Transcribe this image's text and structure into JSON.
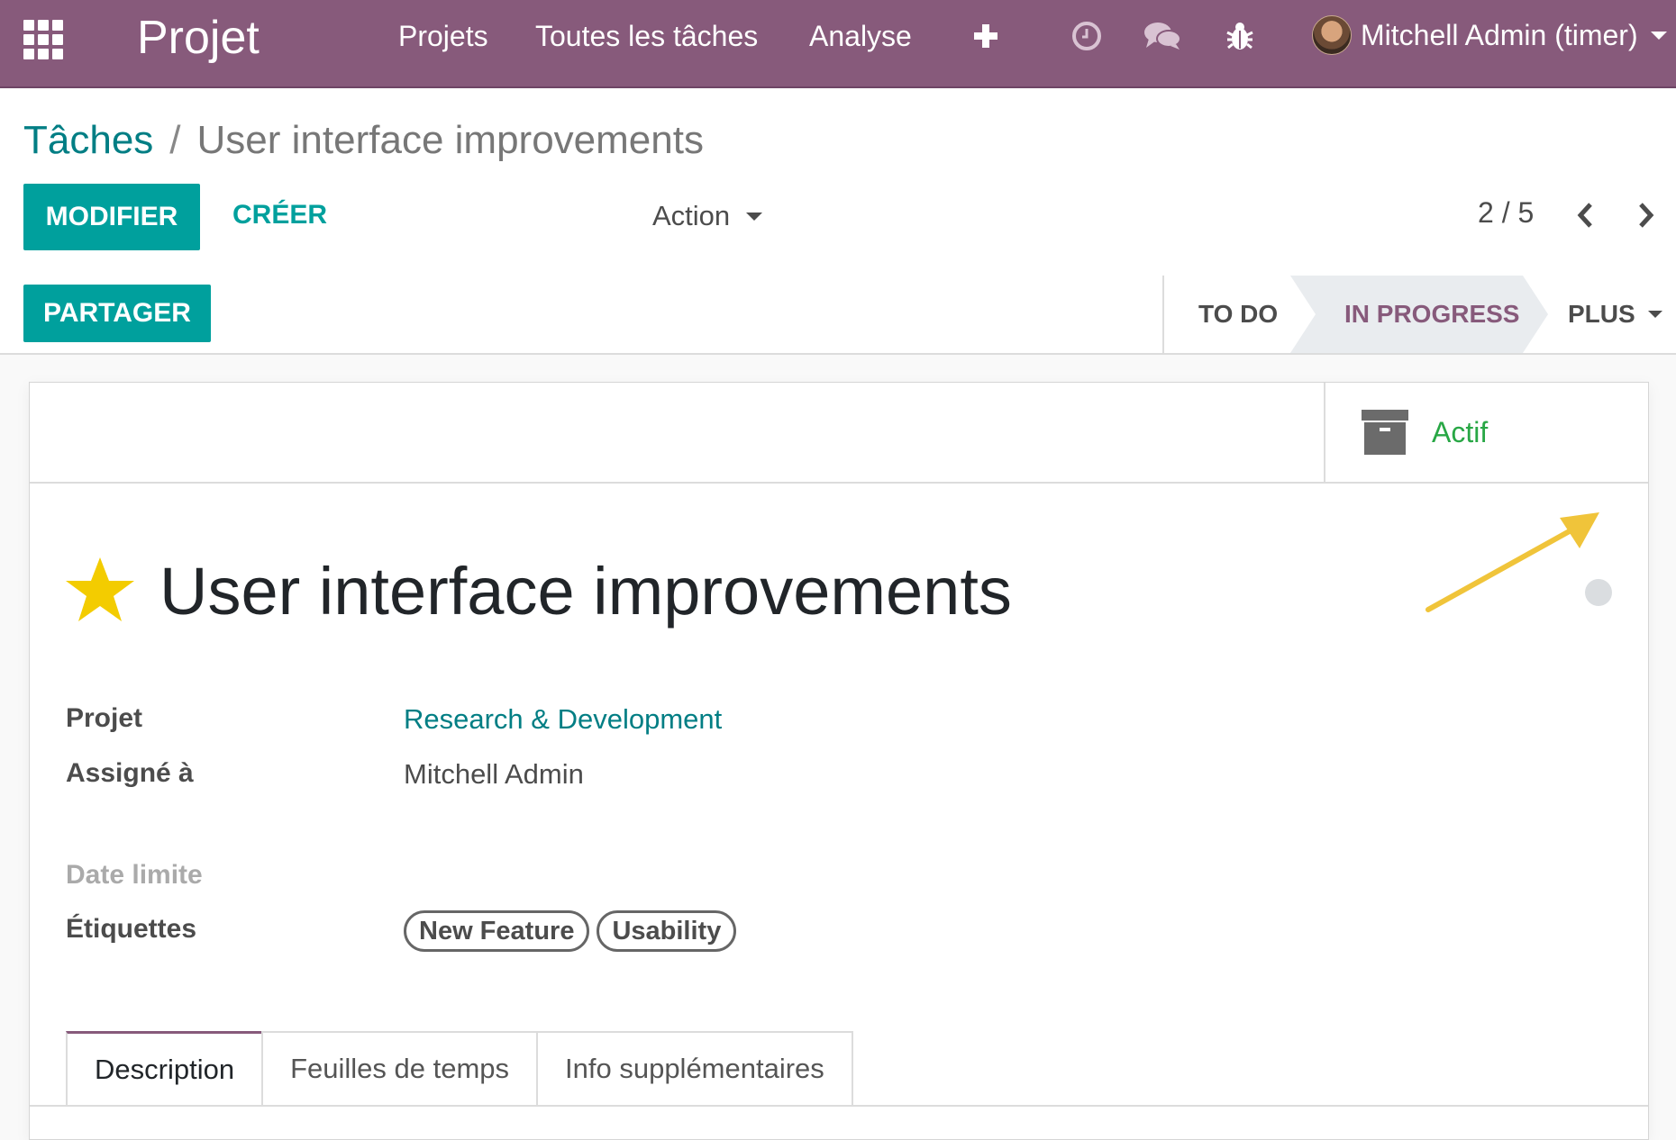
{
  "navbar": {
    "app_name": "Projet",
    "menu": [
      "Projets",
      "Toutes les tâches",
      "Analyse"
    ],
    "icons": [
      "apps-grid-icon",
      "plus-icon",
      "clock-icon",
      "chat-icon",
      "bug-icon"
    ],
    "user": "Mitchell Admin (timer)",
    "color": "#875a7b"
  },
  "breadcrumb": {
    "parent": "Tâches",
    "separator": "/",
    "current": "User interface improvements"
  },
  "control": {
    "edit_label": "MODIFIER",
    "create_label": "CRÉER",
    "action_label": "Action",
    "pager": "2 / 5",
    "share_label": "PARTAGER"
  },
  "stages": {
    "todo": "TO DO",
    "active": "IN PROGRESS",
    "more": "PLUS"
  },
  "archive": {
    "label": "Actif"
  },
  "task": {
    "title": "User interface improvements",
    "starred": true
  },
  "fields": {
    "project_label": "Projet",
    "project_value": "Research & Development",
    "assigned_label": "Assigné à",
    "assigned_value": "Mitchell Admin",
    "deadline_label": "Date limite",
    "tags_label": "Étiquettes",
    "tags": [
      "New Feature",
      "Usability"
    ]
  },
  "tabs": [
    "Description",
    "Feuilles de temps",
    "Info supplémentaires"
  ],
  "colors": {
    "primary": "#00a09d",
    "link": "#017e84",
    "active_status": "#28a745",
    "star": "#f3cc00",
    "annotation_arrow": "#f0c43a"
  }
}
